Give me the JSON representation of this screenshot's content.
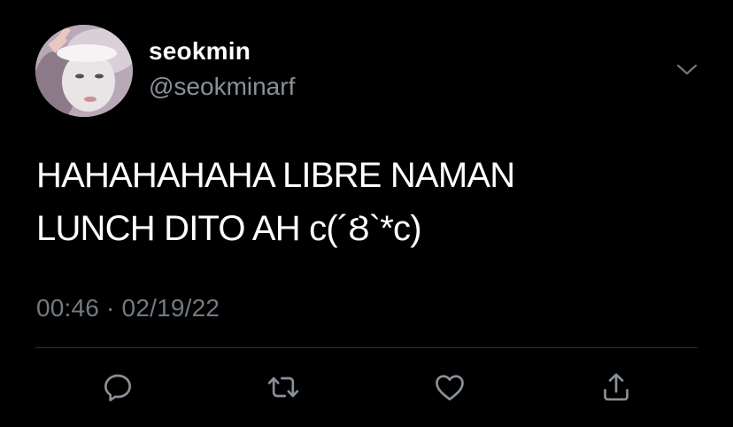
{
  "author": {
    "display_name": "seokmin",
    "handle": "@seokminarf",
    "avatar_icon": "profile-photo"
  },
  "menu": {
    "icon": "chevron-down-icon"
  },
  "tweet": {
    "text_line1": "HAHAHAHAHA LIBRE NAMAN",
    "text_line2": "LUNCH DITO AH c(´Ȣ`*c)",
    "timestamp": "00:46 · 02/19/22"
  },
  "actions": [
    {
      "icon": "reply-icon"
    },
    {
      "icon": "retweet-icon"
    },
    {
      "icon": "like-icon"
    },
    {
      "icon": "share-icon"
    }
  ],
  "colors": {
    "background": "#000000",
    "primary_text": "#ffffff",
    "secondary_text": "#8a9199",
    "icon": "#8a9199",
    "divider": "#2c2f33"
  }
}
